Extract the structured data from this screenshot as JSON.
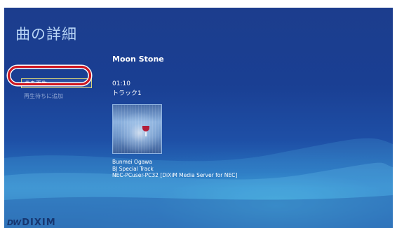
{
  "header": {
    "title": "曲の詳細"
  },
  "track": {
    "title": "Moon Stone",
    "duration": "01:10",
    "number": "トラック1"
  },
  "menu": {
    "play_label": "曲を再生",
    "queue_label": "再生待ちに追加"
  },
  "info": {
    "artist": "Bunmei Ogawa",
    "album": "BJ Special Track",
    "server": "NEC-PCuser-PC32 [DiXiM Media Server for NEC]"
  },
  "brand": {
    "mark": "DW",
    "name": "DIXIM"
  },
  "colors": {
    "background": "#1a3f93",
    "title_text": "#b9d6f6",
    "highlight_ring": "#d0171f",
    "button_border": "#d8d37a"
  }
}
